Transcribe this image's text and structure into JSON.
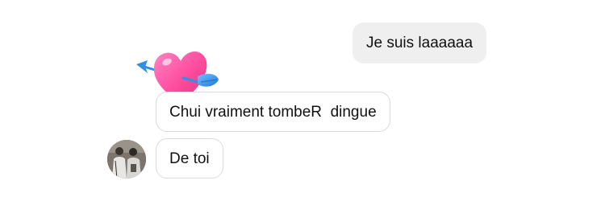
{
  "thread": {
    "sent": [
      {
        "text": "Je suis laaaaaa"
      }
    ],
    "received": [
      {
        "text": "Chui vraiment tombeR  dingue",
        "reaction_icon": "heart-with-arrow-icon"
      },
      {
        "text": "De toi"
      }
    ],
    "avatar_icon": "contact-avatar"
  },
  "colors": {
    "sent_bubble_bg": "#efefef",
    "received_bubble_border": "#dbdbdb",
    "text": "#111111",
    "heart": "#ff4fa0",
    "arrow": "#2d8fe6"
  }
}
